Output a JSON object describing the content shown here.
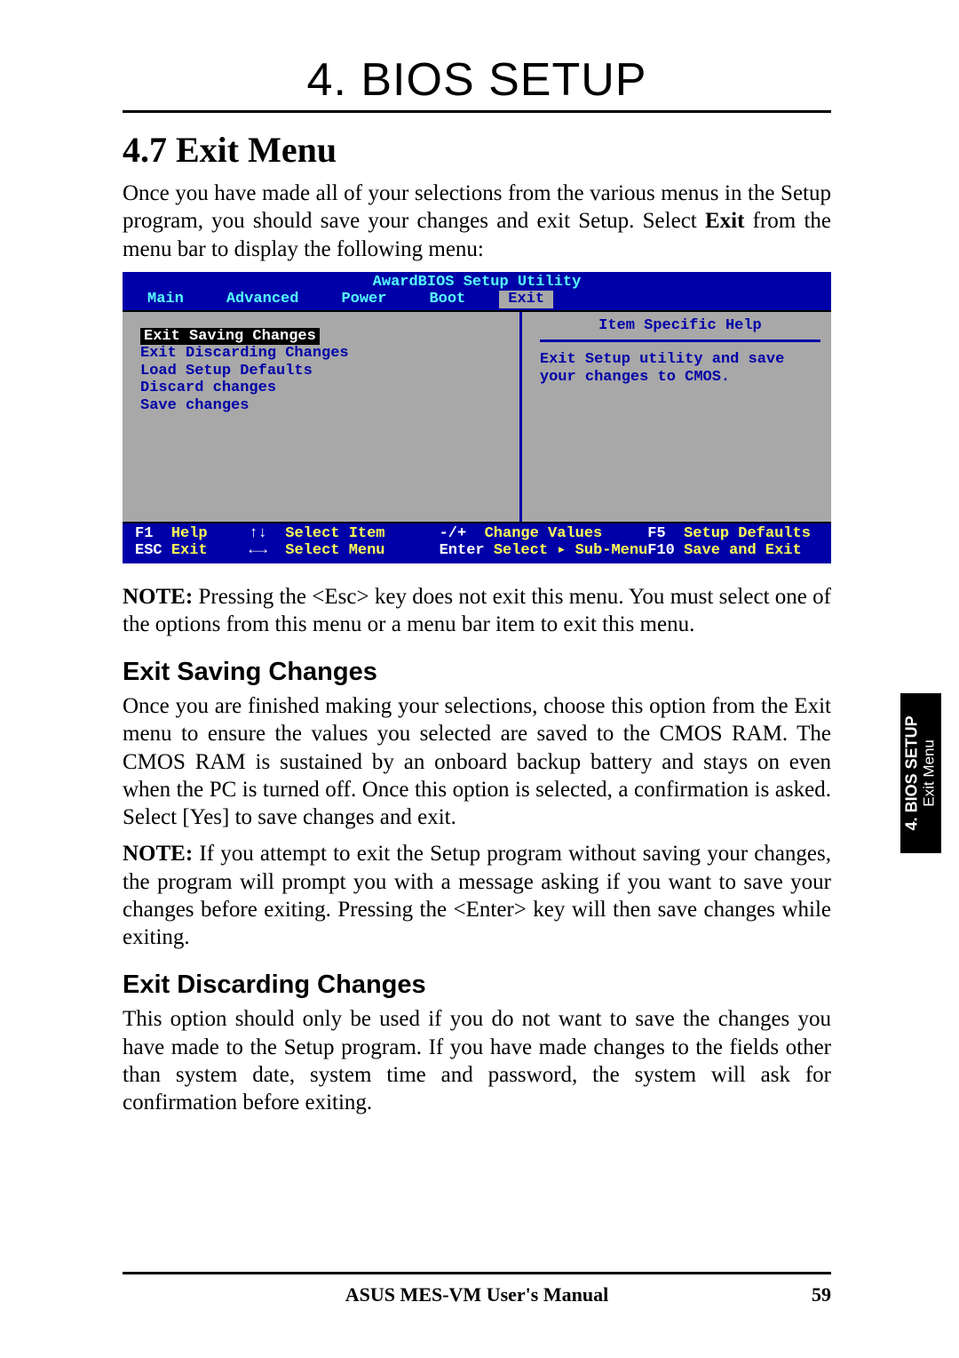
{
  "chapter_title": "4.  BIOS SETUP",
  "section_title": "4.7 Exit Menu",
  "intro_para_pre": "Once you have made all of your selections from the various menus in the Setup program, you should save your changes and exit Setup. Select ",
  "intro_bold": "Exit",
  "intro_para_post": " from the menu bar to display the following menu:",
  "bios": {
    "title": "AwardBIOS Setup Utility",
    "tabs": [
      "Main",
      "Advanced",
      "Power",
      "Boot",
      "Exit"
    ],
    "active_tab_index": 4,
    "menu": {
      "selected": "Exit Saving Changes",
      "items": [
        "Exit Discarding Changes",
        "Load Setup Defaults",
        "Discard changes",
        "Save changes"
      ]
    },
    "help_title": "Item Specific Help",
    "help_text": "Exit Setup utility and save your changes to CMOS.",
    "footer": {
      "r1c1k": "F1",
      "r1c1v": "Help",
      "r1c2k": "↑↓",
      "r1c2v": "Select Item",
      "r1c3k": "-/+",
      "r1c3v": "Change Values",
      "r1c4k": "F5",
      "r1c4v": "Setup Defaults",
      "r2c1k": "ESC",
      "r2c1v": "Exit",
      "r2c2k": "←→",
      "r2c2v": "Select Menu",
      "r2c3k": "Enter",
      "r2c3v": "Select ▸ Sub-Menu",
      "r2c4k": "F10",
      "r2c4v": "Save and Exit"
    }
  },
  "note1_bold": "NOTE:",
  "note1_text": " Pressing the <Esc> key does not exit this menu. You must select one of the options from this menu or a menu bar item to exit this menu.",
  "sub1_heading": "Exit Saving Changes",
  "sub1_para": "Once you are finished making your selections, choose this option from the Exit menu to ensure the values you selected are saved to the CMOS RAM. The CMOS RAM is sustained by an onboard backup battery and stays on even when the PC is turned off. Once this option is selected, a confirmation is asked. Select [Yes] to save changes and exit.",
  "note2_bold": "NOTE:",
  "note2_text": " If you attempt to exit the Setup program without saving your changes, the program will prompt you with a message asking if you want to save your changes before exiting. Pressing the <Enter> key will then save changes while exiting.",
  "sub2_heading": "Exit Discarding Changes",
  "sub2_para": "This option should only be used if you do not want to save the changes you have made to the Setup program. If you have made changes to the fields other than system date, system time and password, the system will ask for confirmation before exiting.",
  "side_tab_bold": "4. BIOS SETUP",
  "side_tab_sub": "Exit Menu",
  "footer_center": "ASUS MES-VM User's Manual",
  "footer_page": "59"
}
